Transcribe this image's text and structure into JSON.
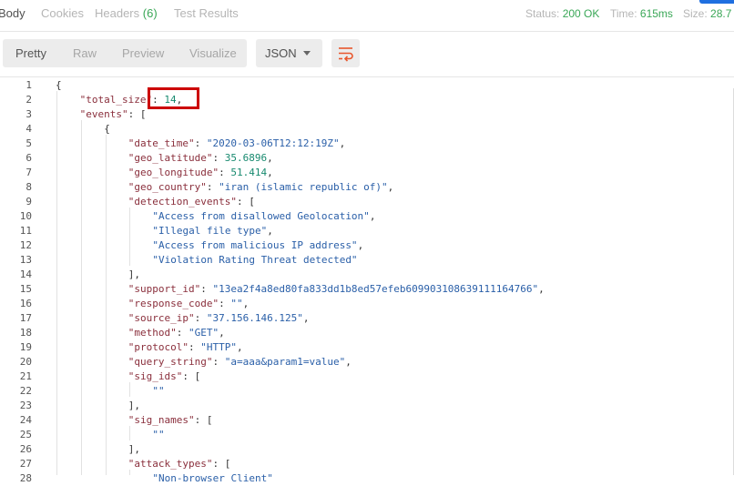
{
  "tabs": [
    {
      "label": "Body"
    },
    {
      "label": "Cookies"
    },
    {
      "label": "Headers",
      "count": "(6)"
    },
    {
      "label": "Test Results"
    }
  ],
  "status": {
    "status_label": "Status:",
    "status_value": "200 OK",
    "time_label": "Time:",
    "time_value": "615ms",
    "size_label": "Size:",
    "size_value": "28.7"
  },
  "view_modes": [
    "Pretty",
    "Raw",
    "Preview",
    "Visualize"
  ],
  "format": {
    "selected": "JSON"
  },
  "lines": [
    {
      "n": "1",
      "t": [
        [
          "p",
          "{"
        ]
      ]
    },
    {
      "n": "2",
      "t": [
        [
          "k",
          "\"total_size\""
        ],
        [
          "p",
          ": "
        ],
        [
          "n",
          "14"
        ],
        [
          "p",
          ","
        ]
      ]
    },
    {
      "n": "3",
      "t": [
        [
          "k",
          "\"events\""
        ],
        [
          "p",
          ": ["
        ]
      ]
    },
    {
      "n": "4",
      "t": [
        [
          "p",
          "{"
        ]
      ]
    },
    {
      "n": "5",
      "t": [
        [
          "k",
          "\"date_time\""
        ],
        [
          "p",
          ": "
        ],
        [
          "s",
          "\"2020-03-06T12:12:19Z\""
        ],
        [
          "p",
          ","
        ]
      ]
    },
    {
      "n": "6",
      "t": [
        [
          "k",
          "\"geo_latitude\""
        ],
        [
          "p",
          ": "
        ],
        [
          "n",
          "35.6896"
        ],
        [
          "p",
          ","
        ]
      ]
    },
    {
      "n": "7",
      "t": [
        [
          "k",
          "\"geo_longitude\""
        ],
        [
          "p",
          ": "
        ],
        [
          "n",
          "51.414"
        ],
        [
          "p",
          ","
        ]
      ]
    },
    {
      "n": "8",
      "t": [
        [
          "k",
          "\"geo_country\""
        ],
        [
          "p",
          ": "
        ],
        [
          "s",
          "\"iran (islamic republic of)\""
        ],
        [
          "p",
          ","
        ]
      ]
    },
    {
      "n": "9",
      "t": [
        [
          "k",
          "\"detection_events\""
        ],
        [
          "p",
          ": ["
        ]
      ]
    },
    {
      "n": "10",
      "t": [
        [
          "s",
          "\"Access from disallowed Geolocation\""
        ],
        [
          "p",
          ","
        ]
      ]
    },
    {
      "n": "11",
      "t": [
        [
          "s",
          "\"Illegal file type\""
        ],
        [
          "p",
          ","
        ]
      ]
    },
    {
      "n": "12",
      "t": [
        [
          "s",
          "\"Access from malicious IP address\""
        ],
        [
          "p",
          ","
        ]
      ]
    },
    {
      "n": "13",
      "t": [
        [
          "s",
          "\"Violation Rating Threat detected\""
        ]
      ]
    },
    {
      "n": "14",
      "t": [
        [
          "p",
          "],"
        ]
      ]
    },
    {
      "n": "15",
      "t": [
        [
          "k",
          "\"support_id\""
        ],
        [
          "p",
          ": "
        ],
        [
          "s",
          "\"13ea2f4a8ed80fa833dd1b8ed57efeb609903108639111164766\""
        ],
        [
          "p",
          ","
        ]
      ]
    },
    {
      "n": "16",
      "t": [
        [
          "k",
          "\"response_code\""
        ],
        [
          "p",
          ": "
        ],
        [
          "s",
          "\"\""
        ],
        [
          "p",
          ","
        ]
      ]
    },
    {
      "n": "17",
      "t": [
        [
          "k",
          "\"source_ip\""
        ],
        [
          "p",
          ": "
        ],
        [
          "s",
          "\"37.156.146.125\""
        ],
        [
          "p",
          ","
        ]
      ]
    },
    {
      "n": "18",
      "t": [
        [
          "k",
          "\"method\""
        ],
        [
          "p",
          ": "
        ],
        [
          "s",
          "\"GET\""
        ],
        [
          "p",
          ","
        ]
      ]
    },
    {
      "n": "19",
      "t": [
        [
          "k",
          "\"protocol\""
        ],
        [
          "p",
          ": "
        ],
        [
          "s",
          "\"HTTP\""
        ],
        [
          "p",
          ","
        ]
      ]
    },
    {
      "n": "20",
      "t": [
        [
          "k",
          "\"query_string\""
        ],
        [
          "p",
          ": "
        ],
        [
          "s",
          "\"a=aaa&param1=value\""
        ],
        [
          "p",
          ","
        ]
      ]
    },
    {
      "n": "21",
      "t": [
        [
          "k",
          "\"sig_ids\""
        ],
        [
          "p",
          ": ["
        ]
      ]
    },
    {
      "n": "22",
      "t": [
        [
          "s",
          "\"\""
        ]
      ]
    },
    {
      "n": "23",
      "t": [
        [
          "p",
          "],"
        ]
      ]
    },
    {
      "n": "24",
      "t": [
        [
          "k",
          "\"sig_names\""
        ],
        [
          "p",
          ": ["
        ]
      ]
    },
    {
      "n": "25",
      "t": [
        [
          "s",
          "\"\""
        ]
      ]
    },
    {
      "n": "26",
      "t": [
        [
          "p",
          "],"
        ]
      ]
    },
    {
      "n": "27",
      "t": [
        [
          "k",
          "\"attack_types\""
        ],
        [
          "p",
          ": ["
        ]
      ]
    },
    {
      "n": "28",
      "t": [
        [
          "s",
          "\"Non-browser Client\""
        ]
      ]
    }
  ],
  "colors": {
    "accent": "#1f6fe0",
    "wrap_icon": "#e8572d",
    "highlight": "#cc0000"
  },
  "icons": {
    "wrap": "wrap-lines-icon",
    "format_caret": "chevron-down-icon"
  }
}
